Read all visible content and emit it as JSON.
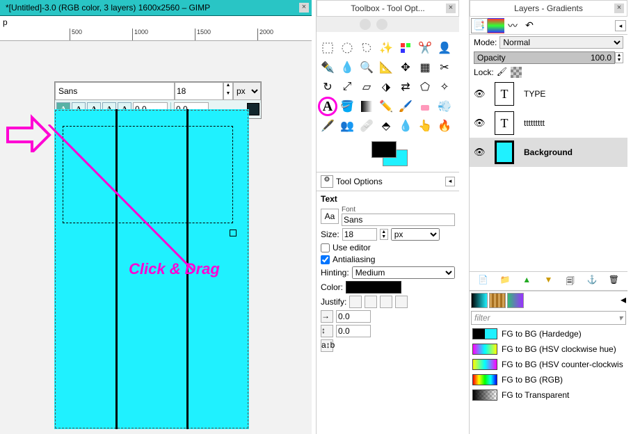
{
  "canvas": {
    "title": "*[Untitled]-3.0 (RGB color, 3 layers) 1600x2560 – GIMP",
    "menu_p": "p",
    "ruler": {
      "t500": "500",
      "t1000": "1000",
      "t1500": "1500",
      "t2000": "2000"
    },
    "annotation": "Click & Drag",
    "text_toolbar": {
      "font": "Sans",
      "size": "18",
      "unit": "px",
      "kern": "0.0",
      "baseline": "0.0"
    }
  },
  "toolbox": {
    "title": "Toolbox - Tool Opt...",
    "tool_options_header": "Tool Options",
    "text_label": "Text",
    "font_label": "Font",
    "font_button": "Aa",
    "font_value": "Sans",
    "size_label": "Size:",
    "size_value": "18",
    "size_unit": "px",
    "use_editor": "Use editor",
    "antialiasing": "Antialiasing",
    "hinting_label": "Hinting:",
    "hinting_value": "Medium",
    "color_label": "Color:",
    "justify_label": "Justify:",
    "indent_value": "0.0",
    "line_value": "0.0",
    "bottom_label": "a↕b"
  },
  "layers": {
    "title": "Layers - Gradients",
    "mode_label": "Mode:",
    "mode_value": "Normal",
    "opacity_label": "Opacity",
    "opacity_value": "100.0",
    "lock_label": "Lock:",
    "items": [
      {
        "name": "TYPE"
      },
      {
        "name": "ttttttttt"
      },
      {
        "name": "Background"
      }
    ],
    "filter_placeholder": "filter",
    "gradients": [
      "FG to BG (Hardedge)",
      "FG to BG (HSV clockwise hue)",
      "FG to BG (HSV counter-clockwis",
      "FG to BG (RGB)",
      "FG to Transparent"
    ]
  }
}
